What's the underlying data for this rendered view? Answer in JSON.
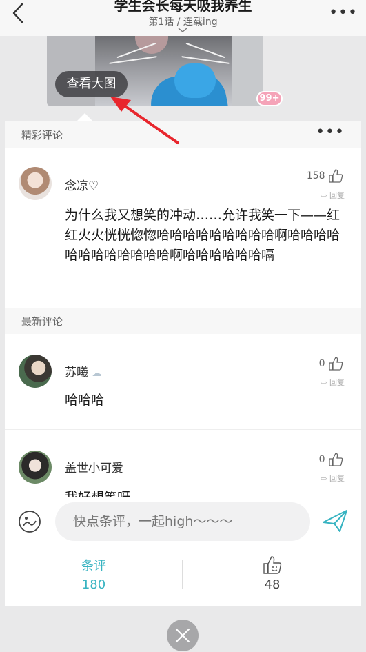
{
  "header": {
    "title": "学生会长每天吸我养生",
    "subtitle": "第1话 / 连载ing"
  },
  "hero": {
    "view_big_label": "查看大图",
    "badge": "99+"
  },
  "featured": {
    "section_label": "精彩评论",
    "comments": [
      {
        "user": "念凉♡",
        "likes": "158",
        "reply_label": "回复",
        "text": "为什么我又想笑的冲动……允许我笑一下——红红火火恍恍惚惚哈哈哈哈哈哈哈哈哈啊哈哈哈哈哈哈哈哈哈哈哈哈啊哈哈哈哈哈哈嗝"
      }
    ]
  },
  "latest": {
    "section_label": "最新评论",
    "comments": [
      {
        "user": "苏曦",
        "likes": "0",
        "reply_label": "回复",
        "text": "哈哈哈"
      },
      {
        "user": "盖世小可爱",
        "likes": "0",
        "reply_label": "回复",
        "text": "我好想笑呀"
      }
    ]
  },
  "input": {
    "placeholder": "快点条评，一起high～～～"
  },
  "stats": {
    "comments_label": "条评",
    "comments_count": "180",
    "likes_count": "48"
  },
  "colors": {
    "accent": "#37b3c1",
    "badge": "#f5a3b8",
    "arrow": "#e8262d"
  }
}
